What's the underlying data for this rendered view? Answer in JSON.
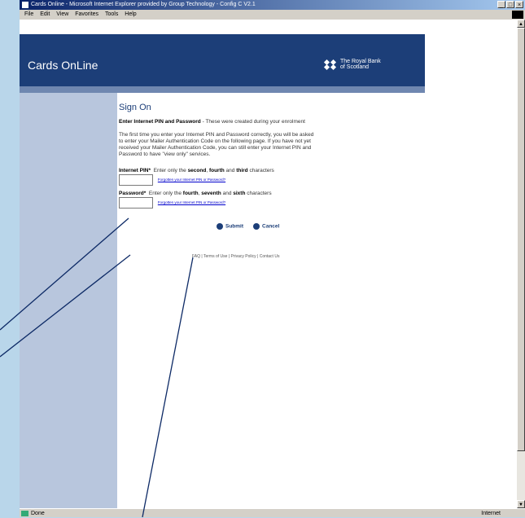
{
  "window": {
    "title": "Cards Online - Microsoft Internet Explorer provided by Group Technology - Config C V2.1",
    "controls": [
      "_",
      "□",
      "×"
    ],
    "menu": [
      "File",
      "Edit",
      "View",
      "Favorites",
      "Tools",
      "Help"
    ]
  },
  "header": {
    "product_name": "Cards OnLine",
    "bank_line1": "The Royal Bank",
    "bank_line2": "of Scotland"
  },
  "signon": {
    "title": "Sign On",
    "intro_bold": "Enter Internet PIN and Password",
    "intro_rest": " - These were created during your enrolment",
    "body": "The first time you enter your Internet PIN and Password correctly, you will be asked to enter your Mailer Authentication Code on the following page. If you have not yet received your Mailer Authentication Code, you can still enter your Internet PIN and Password to have \"view only\" services.",
    "pin_label": "Internet PIN*",
    "pin_instr_pre": "Enter only the ",
    "pin_c1": "second",
    "pin_sep1": ", ",
    "pin_c2": "fourth",
    "pin_sep2": " and ",
    "pin_c3": "third",
    "pin_instr_post": " characters",
    "password_label": "Password*",
    "pw_instr_pre": "Enter only the ",
    "pw_c1": "fourth",
    "pw_sep1": ", ",
    "pw_c2": "seventh",
    "pw_sep2": " and ",
    "pw_c3": "sixth",
    "pw_instr_post": " characters",
    "forgot_link": "Forgotten your Internet PIN or Password?",
    "submit": "Submit",
    "cancel": "Cancel",
    "footer": "FAQ | Terms of Use | Privacy Policy | Contact Us"
  },
  "status": {
    "left": "Done",
    "right": "Internet"
  },
  "colors": {
    "brand_navy": "#1c3e78",
    "annotation_line": "#0d2a66"
  }
}
